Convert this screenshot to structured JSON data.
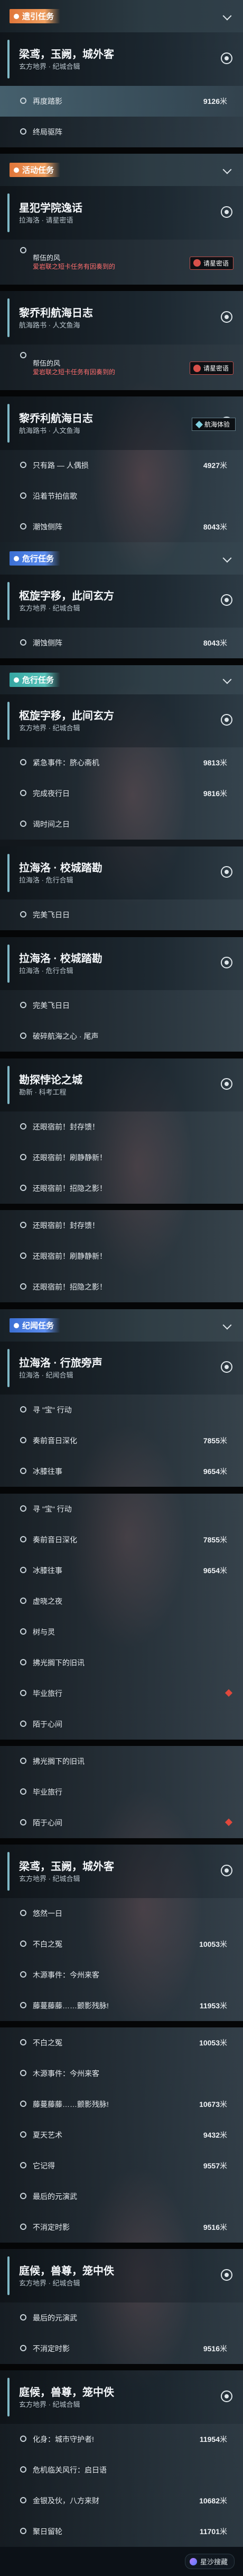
{
  "colors": {
    "orange": "#e0763a",
    "teal": "#36a6a2",
    "blue": "#3b6fd3",
    "warn": "#ff6e6e",
    "marker": "#e0483c"
  },
  "rows": [
    {
      "t": "cat",
      "h": 40,
      "c": "orange",
      "label": "遗引任务"
    },
    {
      "t": "quest",
      "h": 66,
      "title": "梁鸢，玉阙，城外客",
      "sub": "玄方地界 · 纪城合辑"
    },
    {
      "t": "obj",
      "h": 38,
      "text": "再度踏影",
      "dist": "9126",
      "unit": "米",
      "hl": true
    },
    {
      "t": "obj",
      "h": 38,
      "text": "终局驱阵"
    },
    {
      "t": "sep",
      "h": 8
    },
    {
      "t": "cat",
      "h": 40,
      "c": "orange",
      "label": "活动任务"
    },
    {
      "t": "quest",
      "h": 66,
      "title": "星犯学院逸话",
      "sub": "拉海洛 · 请星密语"
    },
    {
      "t": "npc",
      "h": 56,
      "text": "帮伍的风",
      "warn": "爱岩联之短卡任务有因奏到的",
      "badge": "请星密语"
    },
    {
      "t": "sep",
      "h": 8
    },
    {
      "t": "quest",
      "h": 66,
      "title": "黎乔利航海日志",
      "sub": "航海路书 · 人文鱼海"
    },
    {
      "t": "npc",
      "h": 56,
      "text": "帮伍的风",
      "warn": "爱岩联之短卡任务有因奏到的",
      "badge": "请星密语"
    },
    {
      "t": "sep",
      "h": 8
    },
    {
      "t": "quest",
      "h": 66,
      "title": "黎乔利航海日志",
      "sub": "航海路书 · 人文鱼海",
      "nav": "航海体验"
    },
    {
      "t": "obj",
      "h": 38,
      "text": "只有路 — 人偶损",
      "dist": "4927",
      "unit": "米"
    },
    {
      "t": "obj",
      "h": 38,
      "text": "沿着节拍信歌"
    },
    {
      "t": "obj",
      "h": 38,
      "text": "潮蚀侧阵",
      "dist": "8043",
      "unit": "米"
    },
    {
      "t": "cat",
      "h": 40,
      "c": "blue",
      "label": "危行任务"
    },
    {
      "t": "quest",
      "h": 66,
      "title": "枢旋字移，此间玄方",
      "sub": "玄方地界 · 纪城合辑"
    },
    {
      "t": "obj",
      "h": 38,
      "text": "潮蚀侧阵",
      "dist": "8043",
      "unit": "米"
    },
    {
      "t": "sep",
      "h": 8
    },
    {
      "t": "cat",
      "h": 36,
      "c": "teal",
      "label": "危行任务"
    },
    {
      "t": "quest",
      "h": 66,
      "title": "枢旋字移，此间玄方",
      "sub": "玄方地界 · 纪城合辑"
    },
    {
      "t": "obj",
      "h": 38,
      "text": "紧急事件：脐心斋机",
      "dist": "9813",
      "unit": "米"
    },
    {
      "t": "obj",
      "h": 38,
      "text": "完成夜行日",
      "dist": "9816",
      "unit": "米"
    },
    {
      "t": "obj",
      "h": 38,
      "text": "谒时间之日"
    },
    {
      "t": "sep",
      "h": 8,
      "faint": true
    },
    {
      "t": "quest",
      "h": 66,
      "title": "拉海洛 · 校城踏勘",
      "sub": "拉海洛 · 危行合辑"
    },
    {
      "t": "obj",
      "h": 38,
      "text": "完美飞日日"
    },
    {
      "t": "sep",
      "h": 8
    },
    {
      "t": "quest",
      "h": 66,
      "title": "拉海洛 · 校城踏勘",
      "sub": "拉海洛 · 危行合辑"
    },
    {
      "t": "obj",
      "h": 38,
      "text": "完美飞日日"
    },
    {
      "t": "obj",
      "h": 38,
      "text": "破碎航海之心 · 尾声"
    },
    {
      "t": "sep",
      "h": 8
    },
    {
      "t": "quest",
      "h": 66,
      "title": "勘探悖论之城",
      "sub": "勘新 · 科考工程"
    },
    {
      "t": "obj",
      "h": 38,
      "text": "还眼宿前！封存馈！"
    },
    {
      "t": "obj",
      "h": 38,
      "text": "还眼宿前！刷静静新！"
    },
    {
      "t": "obj",
      "h": 38,
      "text": "还眼宿前！招隐之影！"
    },
    {
      "t": "sep",
      "h": 8
    },
    {
      "t": "obj",
      "h": 38,
      "text": "还眼宿前！封存馈！"
    },
    {
      "t": "obj",
      "h": 38,
      "text": "还眼宿前！刷静静新！"
    },
    {
      "t": "obj",
      "h": 38,
      "text": "还眼宿前！招隐之影！"
    },
    {
      "t": "sep",
      "h": 8
    },
    {
      "t": "cat",
      "h": 40,
      "c": "blue",
      "label": "纪闻任务"
    },
    {
      "t": "quest",
      "h": 66,
      "title": "拉海洛 · 行旅旁声",
      "sub": "拉海洛 · 纪闻合辑"
    },
    {
      "t": "obj",
      "h": 38,
      "text": "寻 \"宝\" 行动"
    },
    {
      "t": "obj",
      "h": 38,
      "text": "奏前音日深化",
      "dist": "7855",
      "unit": "米"
    },
    {
      "t": "obj",
      "h": 38,
      "text": "冰膝往事",
      "dist": "9654",
      "unit": "米"
    },
    {
      "t": "sep",
      "h": 8
    },
    {
      "t": "obj",
      "h": 38,
      "text": "寻 \"宝\" 行动"
    },
    {
      "t": "obj",
      "h": 38,
      "text": "奏前音日深化",
      "dist": "7855",
      "unit": "米"
    },
    {
      "t": "obj",
      "h": 38,
      "text": "冰膝往事",
      "dist": "9654",
      "unit": "米"
    },
    {
      "t": "obj",
      "h": 38,
      "text": "虚晓之夜"
    },
    {
      "t": "obj",
      "h": 38,
      "text": "树与灵"
    },
    {
      "t": "obj",
      "h": 38,
      "text": "拂光搁下的旧讯"
    },
    {
      "t": "obj",
      "h": 38,
      "text": "毕业旅行",
      "marker": true
    },
    {
      "t": "obj",
      "h": 38,
      "text": "陌于心间"
    },
    {
      "t": "sep",
      "h": 8
    },
    {
      "t": "obj",
      "h": 38,
      "text": "拂光搁下的旧讯"
    },
    {
      "t": "obj",
      "h": 38,
      "text": "毕业旅行"
    },
    {
      "t": "obj",
      "h": 38,
      "text": "陌于心间",
      "marker": true
    },
    {
      "t": "sep",
      "h": 8
    },
    {
      "t": "quest",
      "h": 66,
      "title": "梁鸢，玉阙，城外客",
      "sub": "玄方地界 · 纪城合辑"
    },
    {
      "t": "obj",
      "h": 38,
      "text": "悠然一日"
    },
    {
      "t": "obj",
      "h": 38,
      "text": "不白之冤",
      "dist": "10053",
      "unit": "米"
    },
    {
      "t": "obj",
      "h": 38,
      "text": "木源事件：今州来客"
    },
    {
      "t": "obj",
      "h": 38,
      "text": "藤蔓藤藤……颤影残脉!",
      "dist": "11953",
      "unit": "米"
    },
    {
      "t": "sep",
      "h": 8
    },
    {
      "t": "obj",
      "h": 38,
      "text": "不白之冤",
      "dist": "10053",
      "unit": "米"
    },
    {
      "t": "obj",
      "h": 38,
      "text": "木源事件：今州来客"
    },
    {
      "t": "obj",
      "h": 38,
      "text": "藤蔓藤藤……颤影残脉!",
      "dist": "10673",
      "unit": "米"
    },
    {
      "t": "obj",
      "h": 38,
      "text": "夏天艺术",
      "dist": "9432",
      "unit": "米"
    },
    {
      "t": "obj",
      "h": 38,
      "text": "它记得",
      "dist": "9557",
      "unit": "米"
    },
    {
      "t": "obj",
      "h": 38,
      "text": "最后的元演武"
    },
    {
      "t": "obj",
      "h": 38,
      "text": "不消定时影",
      "dist": "9516",
      "unit": "米"
    },
    {
      "t": "sep",
      "h": 8
    },
    {
      "t": "quest",
      "h": 66,
      "title": "庭候，兽尊，笼中佚",
      "sub": "玄方地界 · 纪城合辑"
    },
    {
      "t": "obj",
      "h": 38,
      "text": "最后的元演武"
    },
    {
      "t": "obj",
      "h": 38,
      "text": "不消定时影",
      "dist": "9516",
      "unit": "米"
    },
    {
      "t": "sep",
      "h": 8
    },
    {
      "t": "quest",
      "h": 66,
      "title": "庭候，兽尊，笼中佚",
      "sub": "玄方地界 · 纪城合辑"
    },
    {
      "t": "obj",
      "h": 38,
      "text": "化身：城市守护者!",
      "dist": "11954",
      "unit": "米"
    },
    {
      "t": "obj",
      "h": 38,
      "text": "危机临关风行：启日语"
    },
    {
      "t": "obj",
      "h": 38,
      "text": "金银及伙，八方来财",
      "dist": "10682",
      "unit": "米"
    },
    {
      "t": "obj",
      "h": 38,
      "text": "聚日留轮",
      "dist": "11701",
      "unit": "米"
    },
    {
      "t": "search",
      "h": 36,
      "label": "星沙搜藏"
    }
  ]
}
